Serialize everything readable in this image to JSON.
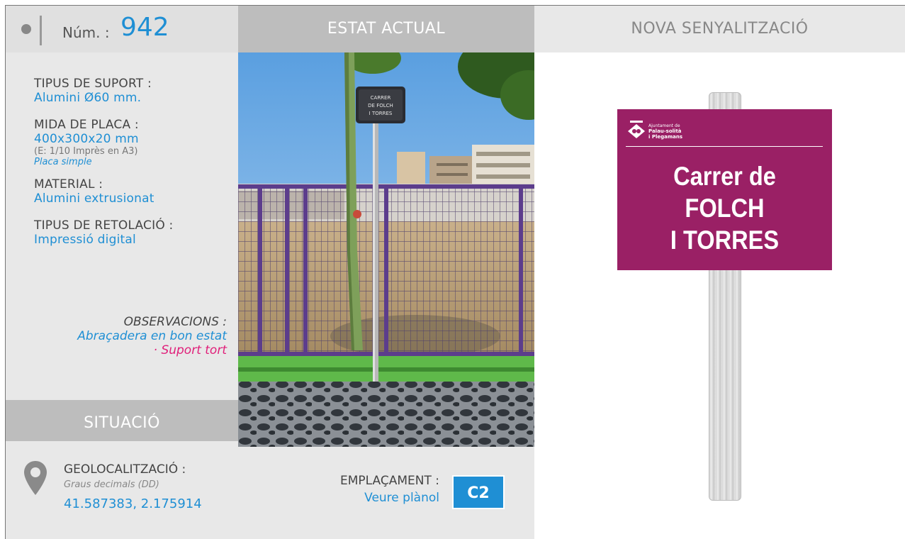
{
  "header": {
    "num_label": "Núm. :",
    "num_value": "942",
    "estat_title": "ESTAT ACTUAL",
    "nova_title": "NOVA SENYALITZACIÓ"
  },
  "fields": {
    "suport_label": "TIPUS DE SUPORT :",
    "suport_value": "Alumini Ø60 mm.",
    "mida_label": "MIDA DE PLACA :",
    "mida_value": "400x300x20 mm",
    "mida_note": "(E: 1/10 Imprès en A3)",
    "mida_type": "Placa simple",
    "material_label": "MATERIAL :",
    "material_value": "Alumini extrusionat",
    "retolacio_label": "TIPUS DE RETOLACIÓ :",
    "retolacio_value": "Impressió digital",
    "obs_label": "OBSERVACIONS :",
    "obs_1": "Abraçadera en bon estat",
    "obs_2": "· Suport tort"
  },
  "situacio": {
    "title": "SITUACIÓ",
    "geo_label": "GEOLOCALITZACIÓ :",
    "geo_note": "Graus decimals (DD)",
    "geo_value": "41.587383, 2.175914",
    "empl_label": "EMPLAÇAMENT :",
    "empl_link": "Veure plànol",
    "empl_code": "C2"
  },
  "photo": {
    "small_sign_lines": [
      "CARRER",
      "DE FOLCH",
      "I TORRES"
    ]
  },
  "sign": {
    "org_line1": "Ajuntament de",
    "org_line2": "Palau-solità",
    "org_line3": "i Plegamans",
    "line1": "Carrer de",
    "line2": "FOLCH",
    "line3": "I TORRES"
  },
  "colors": {
    "accent_blue": "#1f8fd4",
    "accent_pink": "#e0207a",
    "sign_purple": "#9a2065",
    "header_gray": "#bdbdbd",
    "panel_gray": "#e8e8e8"
  },
  "icons": [
    "location-pin-icon",
    "municipal-crest-icon"
  ]
}
